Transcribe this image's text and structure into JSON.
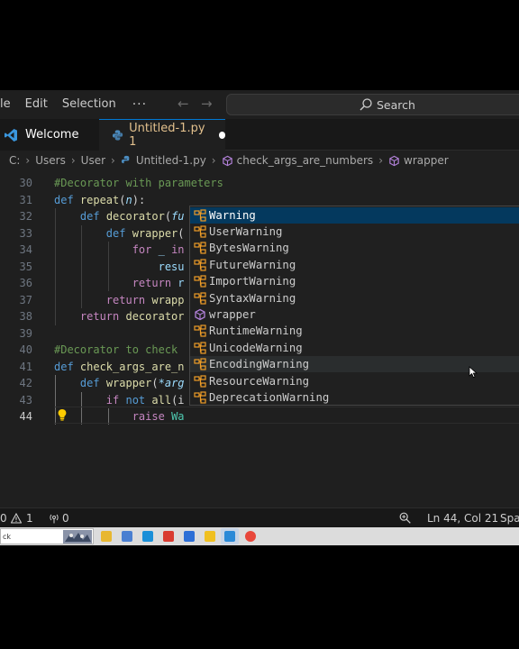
{
  "menu": {
    "items": [
      "le",
      "Edit",
      "Selection"
    ],
    "more": "···",
    "back_arrow": "←",
    "forward_arrow": "→"
  },
  "search": {
    "label": "Search",
    "icon": "search-icon"
  },
  "tabs": [
    {
      "label": "Welcome",
      "icon": "vscode-icon"
    },
    {
      "label": "Untitled-1.py 1",
      "icon": "python-icon",
      "dirty": true,
      "color": "#e2c08d"
    }
  ],
  "breadcrumb": {
    "items": [
      "C:",
      "Users",
      "User",
      "Untitled-1.py",
      "check_args_are_numbers",
      "wrapper"
    ],
    "separator": "›"
  },
  "editor": {
    "lines": [
      {
        "n": "30",
        "tokens": [
          {
            "t": "#Decorator with parameters",
            "c": "cm"
          }
        ]
      },
      {
        "n": "31",
        "tokens": [
          {
            "t": "def ",
            "c": "kw"
          },
          {
            "t": "repeat",
            "c": "fn"
          },
          {
            "t": "(",
            "c": "tx"
          },
          {
            "t": "n",
            "c": "pm"
          },
          {
            "t": "):",
            "c": "tx"
          }
        ]
      },
      {
        "n": "32",
        "tokens": [
          {
            "t": "    ",
            "c": "tx"
          },
          {
            "t": "def ",
            "c": "kw"
          },
          {
            "t": "decorator",
            "c": "fn"
          },
          {
            "t": "(",
            "c": "tx"
          },
          {
            "t": "fu",
            "c": "pm"
          }
        ]
      },
      {
        "n": "33",
        "tokens": [
          {
            "t": "        ",
            "c": "tx"
          },
          {
            "t": "def ",
            "c": "kw"
          },
          {
            "t": "wrapper",
            "c": "fn"
          },
          {
            "t": "(",
            "c": "tx"
          }
        ]
      },
      {
        "n": "34",
        "tokens": [
          {
            "t": "            ",
            "c": "tx"
          },
          {
            "t": "for",
            "c": "kc"
          },
          {
            "t": " _ ",
            "c": "va"
          },
          {
            "t": "in",
            "c": "kc"
          }
        ]
      },
      {
        "n": "35",
        "tokens": [
          {
            "t": "                ",
            "c": "tx"
          },
          {
            "t": "resu",
            "c": "va"
          }
        ]
      },
      {
        "n": "36",
        "tokens": [
          {
            "t": "            ",
            "c": "tx"
          },
          {
            "t": "return ",
            "c": "kc"
          },
          {
            "t": "r",
            "c": "va"
          }
        ]
      },
      {
        "n": "37",
        "tokens": [
          {
            "t": "        ",
            "c": "tx"
          },
          {
            "t": "return ",
            "c": "kc"
          },
          {
            "t": "wrapp",
            "c": "fn"
          }
        ]
      },
      {
        "n": "38",
        "tokens": [
          {
            "t": "    ",
            "c": "tx"
          },
          {
            "t": "return ",
            "c": "kc"
          },
          {
            "t": "decorator",
            "c": "fn"
          }
        ]
      },
      {
        "n": "39",
        "tokens": []
      },
      {
        "n": "40",
        "tokens": [
          {
            "t": "#Decorator to check",
            "c": "cm"
          }
        ]
      },
      {
        "n": "41",
        "tokens": [
          {
            "t": "def ",
            "c": "kw"
          },
          {
            "t": "check_args_are_n",
            "c": "fn"
          }
        ]
      },
      {
        "n": "42",
        "tokens": [
          {
            "t": "    ",
            "c": "tx"
          },
          {
            "t": "def ",
            "c": "kw"
          },
          {
            "t": "wrapper",
            "c": "fn"
          },
          {
            "t": "(",
            "c": "tx"
          },
          {
            "t": "*arg",
            "c": "pm"
          }
        ]
      },
      {
        "n": "43",
        "tokens": [
          {
            "t": "        ",
            "c": "tx"
          },
          {
            "t": "if ",
            "c": "kc"
          },
          {
            "t": "not ",
            "c": "kw"
          },
          {
            "t": "all",
            "c": "fn"
          },
          {
            "t": "(i",
            "c": "tx"
          }
        ]
      },
      {
        "n": "44",
        "tokens": [
          {
            "t": "            ",
            "c": "tx"
          },
          {
            "t": "raise ",
            "c": "kc"
          },
          {
            "t": "Wa",
            "c": "cls"
          }
        ],
        "current": true
      }
    ]
  },
  "suggestions": [
    {
      "label": "Warning",
      "icon": "class-icon",
      "state": "selected"
    },
    {
      "label": "UserWarning",
      "icon": "class-icon"
    },
    {
      "label": "BytesWarning",
      "icon": "class-icon"
    },
    {
      "label": "FutureWarning",
      "icon": "class-icon"
    },
    {
      "label": "ImportWarning",
      "icon": "class-icon"
    },
    {
      "label": "SyntaxWarning",
      "icon": "class-icon"
    },
    {
      "label": "wrapper",
      "icon": "method-icon"
    },
    {
      "label": "RuntimeWarning",
      "icon": "class-icon"
    },
    {
      "label": "UnicodeWarning",
      "icon": "class-icon"
    },
    {
      "label": "EncodingWarning",
      "icon": "class-icon",
      "state": "hover"
    },
    {
      "label": "ResourceWarning",
      "icon": "class-icon"
    },
    {
      "label": "DeprecationWarning",
      "icon": "class-icon"
    }
  ],
  "status": {
    "errors": "0",
    "warnings": "1",
    "ports": "0",
    "position": "Ln 44, Col 21",
    "spaces": "Spac"
  },
  "taskbar": {
    "search_text": "ck"
  },
  "colors": {
    "accent": "#0078d4",
    "editor_bg": "#1f1f1f",
    "selection": "#04395e",
    "class_icon": "#ee9d28",
    "method_icon": "#b180d7"
  }
}
